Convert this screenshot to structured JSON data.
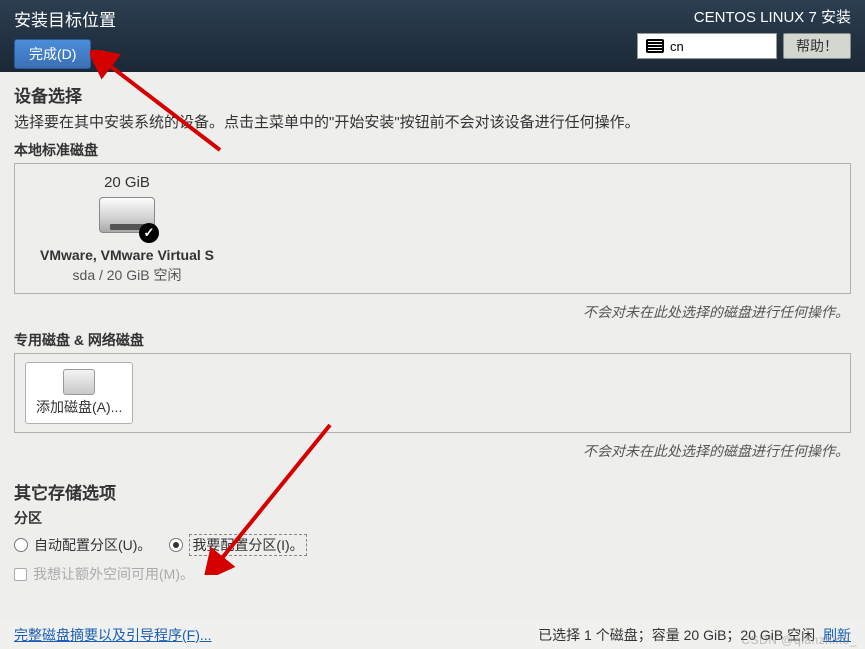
{
  "header": {
    "title": "安装目标位置",
    "done_label": "完成(D)",
    "product": "CENTOS LINUX 7 安装",
    "keyboard": "cn",
    "help_label": "帮助！"
  },
  "device": {
    "section_title": "设备选择",
    "desc": "选择要在其中安装系统的设备。点击主菜单中的\"开始安装\"按钮前不会对该设备进行任何操作。",
    "local_label": "本地标准磁盘",
    "disk": {
      "size": "20 GiB",
      "name": "VMware, VMware Virtual S",
      "info": "sda    /    20 GiB 空闲"
    },
    "note": "不会对未在此处选择的磁盘进行任何操作。",
    "special_label": "专用磁盘 & 网络磁盘",
    "add_disk_label": "添加磁盘(A)..."
  },
  "other": {
    "title": "其它存储选项",
    "part_label": "分区",
    "auto_label": "自动配置分区(U)。",
    "manual_label": "我要配置分区(I)。",
    "encrypt_label": "我想让额外空间可用(M)。"
  },
  "footer": {
    "summary_link": "完整磁盘摘要以及引导程序(F)...",
    "status": "已选择 1 个磁盘；容量 20 GiB；20 GiB 空闲",
    "refresh": "刷新"
  },
  "watermark": "CSDN @qianzhine_"
}
